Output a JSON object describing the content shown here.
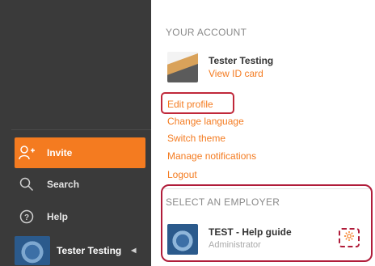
{
  "sidebar": {
    "items": [
      {
        "label": "Invite",
        "icon": "add-user-icon"
      },
      {
        "label": "Search",
        "icon": "search-icon"
      },
      {
        "label": "Help",
        "icon": "help-icon"
      }
    ],
    "user": {
      "name": "Tester Testing"
    }
  },
  "account": {
    "section_title": "YOUR ACCOUNT",
    "name": "Tester Testing",
    "view_id": "View ID card",
    "links": [
      "Edit profile",
      "Change language",
      "Switch theme",
      "Manage notifications",
      "Logout"
    ]
  },
  "employer": {
    "section_title": "SELECT AN EMPLOYER",
    "name": "TEST - Help guide",
    "role": "Administrator"
  },
  "colors": {
    "accent": "#f47b20",
    "sidebar": "#3a3a3a",
    "highlight": "#b01c3a"
  }
}
